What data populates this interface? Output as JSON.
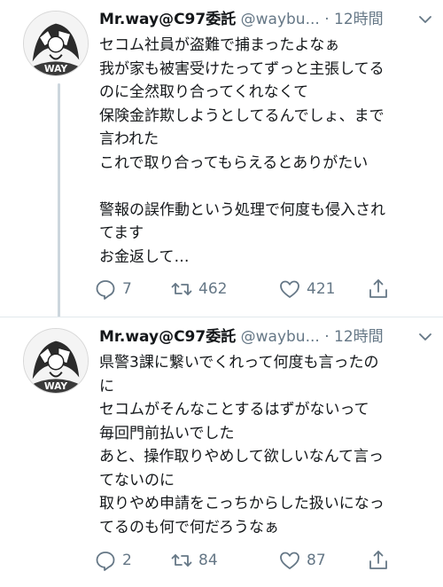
{
  "tweets": [
    {
      "display_name": "Mr.way@C97委託",
      "handle": "@waybu...",
      "separator": "·",
      "time": "12時間",
      "lines": [
        "セコム社員が盗難で捕まったよなぁ",
        "我が家も被害受けたってずっと主張してる",
        "のに全然取り合ってくれなくて",
        "保険金詐欺しようとしてるんでしょ、まで",
        "言われた",
        "これで取り合ってもらえるとありがたい",
        "",
        "警報の誤作動という処理で何度も侵入され",
        "てます",
        "お金返して…"
      ],
      "replies": "7",
      "retweets": "462",
      "likes": "421"
    },
    {
      "display_name": "Mr.way@C97委託",
      "handle": "@waybu...",
      "separator": "·",
      "time": "12時間",
      "lines": [
        "県警3課に繋いでくれって何度も言ったの",
        "に",
        "セコムがそんなことするはずがないって",
        "毎回門前払いでした",
        "あと、操作取りやめして欲しいなんて言っ",
        "てないのに",
        "取りやめ申請をこっちからした扱いになっ",
        "てるのも何で何だろうなぁ"
      ],
      "replies": "2",
      "retweets": "84",
      "likes": "87"
    }
  ],
  "avatar_logo_text": "WAY",
  "icons": {
    "reply": "reply-icon",
    "retweet": "retweet-icon",
    "like": "heart-icon",
    "share": "share-icon",
    "caret": "chevron-down-icon"
  },
  "colors": {
    "text": "#14171a",
    "secondary": "#657786",
    "divider": "#e1e8ed",
    "thread_line": "#ccd6dd"
  }
}
